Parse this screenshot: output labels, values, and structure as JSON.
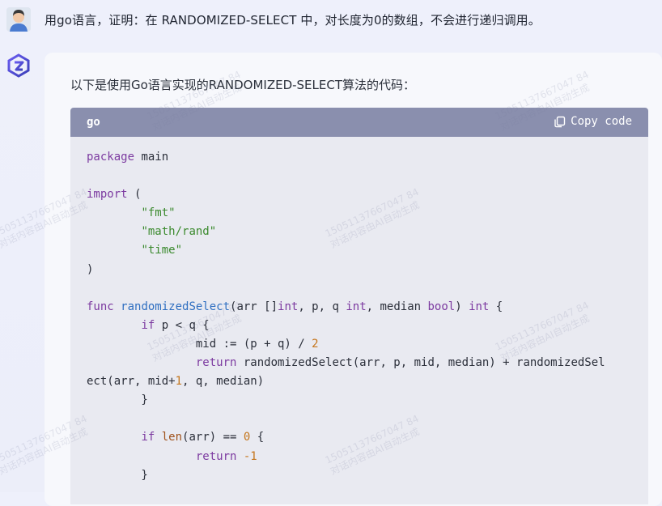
{
  "user": {
    "message": "用go语言，证明：在 RANDOMIZED-SELECT 中，对长度为0的数组，不会进行递归调用。"
  },
  "answer": {
    "intro": "以下是使用Go语言实现的RANDOMIZED-SELECT算法的代码："
  },
  "code_block": {
    "language": "go",
    "copy_label": "Copy code"
  },
  "watermark": {
    "line1": "15051137667047 84",
    "line2": "对话内容由AI自动生成"
  },
  "colors": {
    "code_header": "#8a8fae",
    "code_body": "#e9eaf1",
    "keyword": "#7c3aa0",
    "function": "#2f6fc1",
    "string": "#3b8a2e",
    "number": "#c5761c"
  },
  "icons": {
    "user_avatar": "person-avatar-icon",
    "bot_avatar": "assistant-logo-icon",
    "copy": "copy-icon"
  }
}
